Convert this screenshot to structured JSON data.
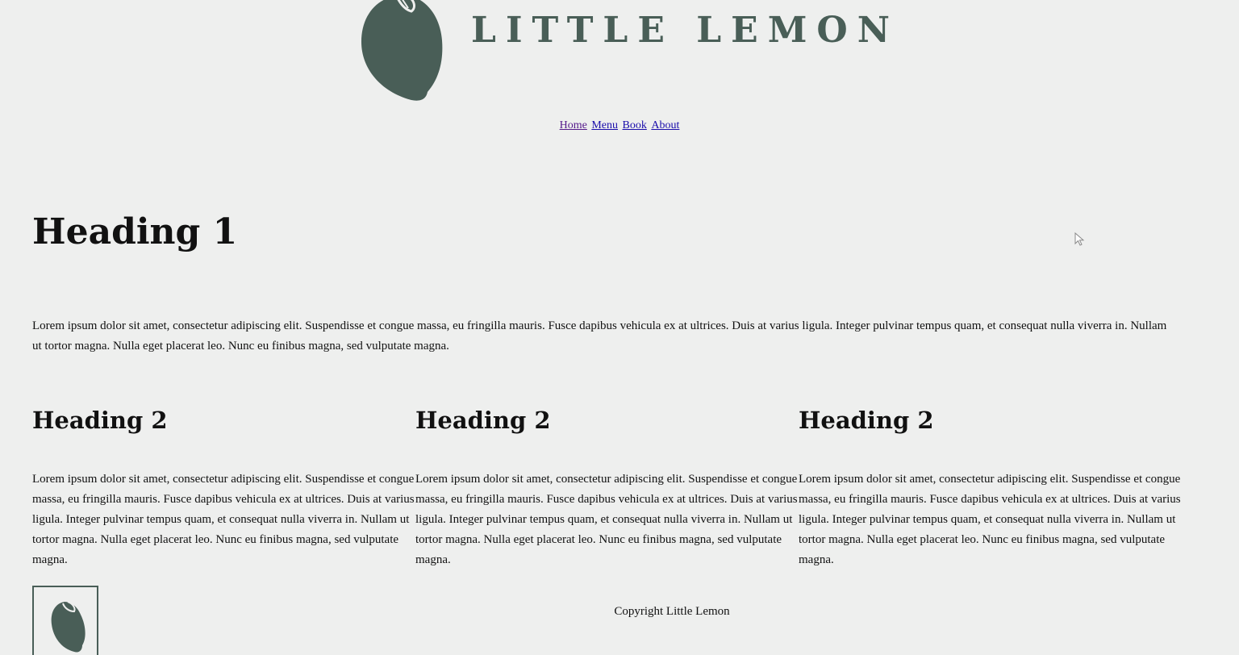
{
  "brand": {
    "name": "LITTLE LEMON",
    "color": "#495e57"
  },
  "nav": {
    "items": [
      "Home",
      "Menu",
      "Book",
      "About"
    ]
  },
  "main": {
    "heading1": "Heading 1",
    "intro": "Lorem ipsum dolor sit amet, consectetur adipiscing elit. Suspendisse et congue massa, eu fringilla mauris. Fusce dapibus vehicula ex at ultrices. Duis at varius ligula. Integer pulvinar tempus quam, et consequat nulla viverra in. Nullam ut tortor magna. Nulla eget placerat leo. Nunc eu finibus magna, sed vulputate magna.",
    "columns": [
      {
        "heading": "Heading 2",
        "text": "Lorem ipsum dolor sit amet, consectetur adipiscing elit. Suspendisse et congue massa, eu fringilla mauris. Fusce dapibus vehicula ex at ultrices. Duis at varius ligula. Integer pulvinar tempus quam, et consequat nulla viverra in. Nullam ut tortor magna. Nulla eget placerat leo. Nunc eu finibus magna, sed vulputate magna."
      },
      {
        "heading": "Heading 2",
        "text": "Lorem ipsum dolor sit amet, consectetur adipiscing elit. Suspendisse et congue massa, eu fringilla mauris. Fusce dapibus vehicula ex at ultrices. Duis at varius ligula. Integer pulvinar tempus quam, et consequat nulla viverra in. Nullam ut tortor magna. Nulla eget placerat leo. Nunc eu finibus magna, sed vulputate magna."
      },
      {
        "heading": "Heading 2",
        "text": "Lorem ipsum dolor sit amet, consectetur adipiscing elit. Suspendisse et congue massa, eu fringilla mauris. Fusce dapibus vehicula ex at ultrices. Duis at varius ligula. Integer pulvinar tempus quam, et consequat nulla viverra in. Nullam ut tortor magna. Nulla eget placerat leo. Nunc eu finibus magna, sed vulputate magna."
      }
    ]
  },
  "footer": {
    "copyright": "Copyright Little Lemon"
  }
}
